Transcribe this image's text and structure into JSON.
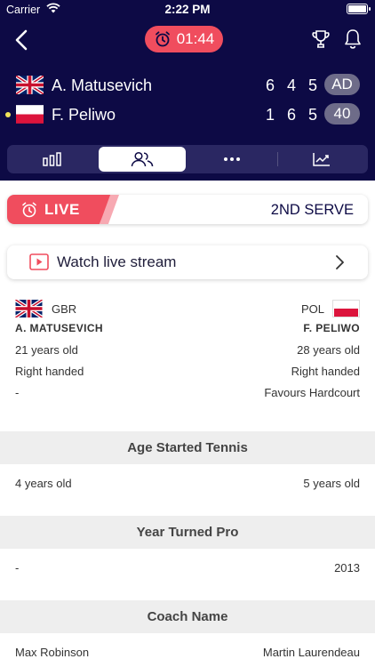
{
  "status_bar": {
    "carrier": "Carrier",
    "time": "2:22 PM"
  },
  "header": {
    "timer": "01:44",
    "players": [
      {
        "name": "A. Matusevich",
        "flag": "gbr-flag",
        "sets": [
          "6",
          "4",
          "5"
        ],
        "game_score": "AD",
        "serving": false
      },
      {
        "name": "F. Peliwo",
        "flag": "pol-flag",
        "sets": [
          "1",
          "6",
          "5"
        ],
        "game_score": "40",
        "serving": true
      }
    ],
    "tabs": [
      {
        "icon": "stats-bars-icon",
        "active": false
      },
      {
        "icon": "players-icon",
        "active": true
      },
      {
        "icon": "more-dots-icon",
        "active": false
      },
      {
        "icon": "trend-chart-icon",
        "active": false
      }
    ]
  },
  "live_banner": {
    "live_label": "LIVE",
    "serve_label": "2ND SERVE"
  },
  "stream": {
    "label": "Watch live stream"
  },
  "comparison": {
    "left": {
      "country": "GBR",
      "name": "A. MATUSEVICH",
      "age": "21 years old",
      "hand": "Right handed",
      "surface": "-"
    },
    "right": {
      "country": "POL",
      "name": "F. PELIWO",
      "age": "28 years old",
      "hand": "Right handed",
      "surface": "Favours Hardcourt"
    }
  },
  "sections": [
    {
      "title": "Age Started Tennis",
      "left": "4 years old",
      "right": "5 years old"
    },
    {
      "title": "Year Turned Pro",
      "left": "-",
      "right": "2013"
    },
    {
      "title": "Coach Name",
      "left": "Max Robinson",
      "right": "Martin Laurendeau"
    }
  ],
  "colors": {
    "navy": "#0d0a45",
    "accent_red": "#f04d5e",
    "serve_yellow": "#f1e45a"
  }
}
